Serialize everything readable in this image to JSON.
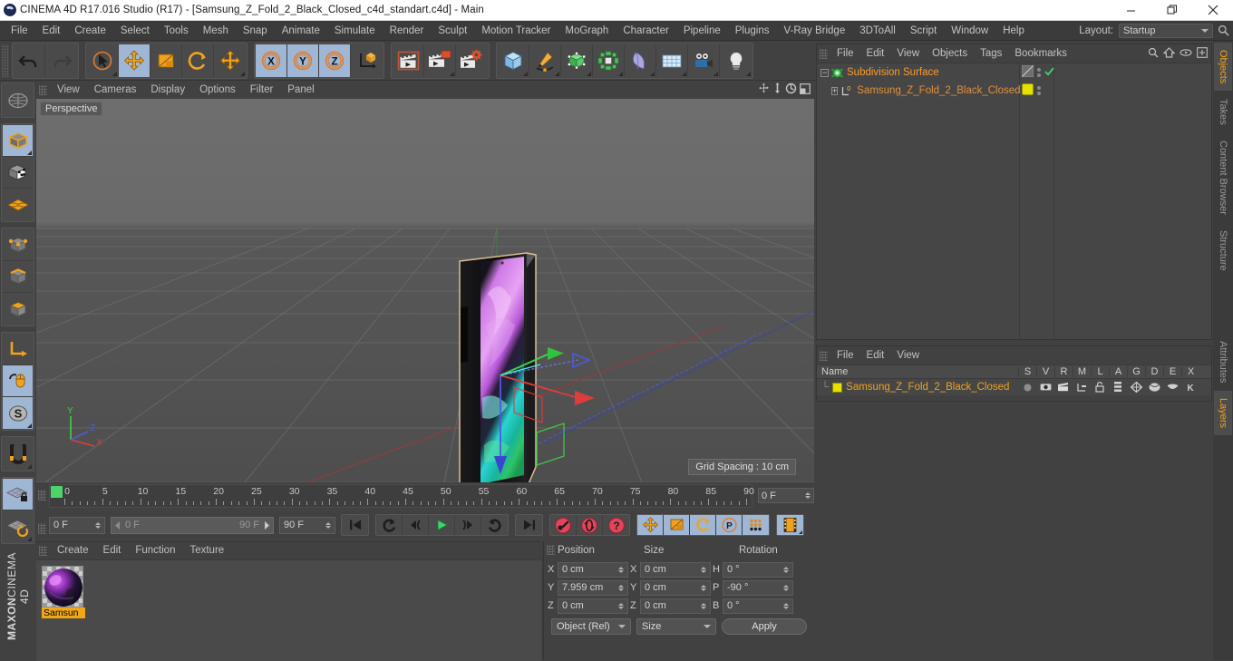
{
  "titlebar": {
    "title": "CINEMA 4D R17.016 Studio (R17) - [Samsung_Z_Fold_2_Black_Closed_c4d_standart.c4d] - Main",
    "minimize": "minimize-icon",
    "maximize": "maximize-icon",
    "close": "close-icon"
  },
  "menubar": {
    "items": [
      {
        "label": "File"
      },
      {
        "label": "Edit"
      },
      {
        "label": "Create"
      },
      {
        "label": "Select"
      },
      {
        "label": "Tools"
      },
      {
        "label": "Mesh"
      },
      {
        "label": "Snap"
      },
      {
        "label": "Animate"
      },
      {
        "label": "Simulate"
      },
      {
        "label": "Render"
      },
      {
        "label": "Sculpt"
      },
      {
        "label": "Motion Tracker"
      },
      {
        "label": "MoGraph"
      },
      {
        "label": "Character"
      },
      {
        "label": "Pipeline"
      },
      {
        "label": "Plugins"
      },
      {
        "label": "V-Ray Bridge"
      },
      {
        "label": "3DToAll"
      },
      {
        "label": "Script"
      },
      {
        "label": "Window"
      },
      {
        "label": "Help"
      }
    ],
    "layout_label": "Layout:",
    "layout_value": "Startup",
    "search_icon": "search-icon"
  },
  "toolbar": {
    "groups": [
      {
        "buttons": [
          {
            "name": "undo-button",
            "icon": "undo-arrow",
            "active": false,
            "corner": false
          },
          {
            "name": "redo-button",
            "icon": "redo-arrow",
            "active": false,
            "corner": false
          }
        ]
      },
      {
        "buttons": [
          {
            "name": "live-selection-tool",
            "icon": "cursor-circle",
            "active": false,
            "corner": true
          },
          {
            "name": "move-tool",
            "icon": "move-cross",
            "active": true,
            "corner": false
          },
          {
            "name": "scale-tool",
            "icon": "scale-box",
            "active": false,
            "corner": false
          },
          {
            "name": "rotate-tool",
            "icon": "rotate-arc",
            "active": false,
            "corner": false
          },
          {
            "name": "move-tool-alt",
            "icon": "move-cross",
            "active": false,
            "corner": true
          }
        ]
      },
      {
        "buttons": [
          {
            "name": "axis-x-toggle",
            "icon": "letter-x",
            "active": true,
            "corner": false
          },
          {
            "name": "axis-y-toggle",
            "icon": "letter-y",
            "active": true,
            "corner": false
          },
          {
            "name": "axis-z-toggle",
            "icon": "letter-z",
            "active": true,
            "corner": false
          },
          {
            "name": "coordinate-system-toggle",
            "icon": "axis-cube",
            "active": false,
            "corner": false
          }
        ]
      },
      {
        "buttons": [
          {
            "name": "render-view-button",
            "icon": "clapper-frame",
            "active": false,
            "corner": false
          },
          {
            "name": "render-to-picture-viewer-button",
            "icon": "clapper-window",
            "active": false,
            "corner": true
          },
          {
            "name": "render-settings-button",
            "icon": "clapper-gear",
            "active": false,
            "corner": false
          }
        ]
      },
      {
        "buttons": [
          {
            "name": "add-cube-button",
            "icon": "blue-cube",
            "active": false,
            "corner": true
          },
          {
            "name": "add-spline-button",
            "icon": "pen-spline",
            "active": false,
            "corner": true
          },
          {
            "name": "nurbs-button",
            "icon": "green-cube-points",
            "active": false,
            "corner": true
          },
          {
            "name": "array-button",
            "icon": "green-cluster",
            "active": false,
            "corner": true
          },
          {
            "name": "deformer-button",
            "icon": "bend-deformer",
            "active": false,
            "corner": true
          },
          {
            "name": "scene-floor-button",
            "icon": "floor-grid",
            "active": false,
            "corner": true
          },
          {
            "name": "camera-button",
            "icon": "camera",
            "active": false,
            "corner": true
          },
          {
            "name": "light-button",
            "icon": "light-bulb",
            "active": false,
            "corner": true
          }
        ]
      }
    ]
  },
  "left_toolbar": {
    "buttons": [
      {
        "name": "world-axis-tool",
        "icon": "globe-axis",
        "active": false,
        "corner": false
      },
      {
        "name": "model-mode-button",
        "icon": "orange-cube-outline",
        "active": true,
        "corner": true
      },
      {
        "name": "texture-mode-button",
        "icon": "checker-cube",
        "active": false,
        "corner": false
      },
      {
        "name": "polygon-mode-button",
        "icon": "orange-mesh-plane",
        "active": false,
        "corner": false
      },
      {
        "name": "point-mode-button",
        "icon": "cube-points",
        "active": false,
        "corner": false
      },
      {
        "name": "edge-mode-button",
        "icon": "cube-edge",
        "active": false,
        "corner": false
      },
      {
        "name": "polygon-face-mode-button",
        "icon": "cube-face",
        "active": false,
        "corner": false
      },
      {
        "name": "axis-modify-button",
        "icon": "corner-axis",
        "active": false,
        "corner": false
      },
      {
        "name": "enable-axis-button",
        "icon": "mouse-axis",
        "active": true,
        "corner": false
      },
      {
        "name": "soft-selection-button",
        "icon": "letter-s-circle",
        "active": true,
        "corner": true
      },
      {
        "name": "magnet-tool",
        "icon": "magnet",
        "active": false,
        "corner": true
      },
      {
        "name": "lock-workplane-button",
        "icon": "grid-lock",
        "active": true,
        "corner": false
      },
      {
        "name": "workplane-rotate-button",
        "icon": "grid-rotate",
        "active": false,
        "corner": true
      }
    ],
    "brand_top": "MAXON",
    "brand_bottom": "CINEMA 4D"
  },
  "viewport": {
    "menu": [
      {
        "label": "View"
      },
      {
        "label": "Cameras"
      },
      {
        "label": "Display"
      },
      {
        "label": "Options"
      },
      {
        "label": "Filter"
      },
      {
        "label": "Panel"
      }
    ],
    "nav_icons": [
      {
        "name": "pan-view-icon"
      },
      {
        "name": "dolly-view-icon"
      },
      {
        "name": "rotate-view-icon"
      },
      {
        "name": "maximize-view-icon"
      }
    ],
    "perspective_label": "Perspective",
    "grid_spacing": "Grid Spacing : 10 cm",
    "axis_labels": {
      "x": "X",
      "y": "Y",
      "z": "Z"
    },
    "colors": {
      "axis_x": "#e03c3c",
      "axis_y": "#3fd24a",
      "axis_z": "#4a5ae0",
      "background_top": "#6a6a6a",
      "background_bottom": "#4b4b4b"
    }
  },
  "timeline": {
    "ticks": [
      0,
      5,
      10,
      15,
      20,
      25,
      30,
      35,
      40,
      45,
      50,
      55,
      60,
      65,
      70,
      75,
      80,
      85,
      90
    ],
    "current_frame_field": "0 F",
    "start_field": "0 F",
    "range_start": "0 F",
    "range_end": "90 F",
    "end_field": "90 F"
  },
  "transport": {
    "buttons": [
      {
        "name": "go-to-start-button",
        "icon": "skip-start"
      },
      {
        "name": "go-to-previous-key-button",
        "icon": "prev-key"
      },
      {
        "name": "step-back-button",
        "icon": "step-back"
      },
      {
        "name": "play-button",
        "icon": "play-triangle"
      },
      {
        "name": "step-forward-button",
        "icon": "step-forward"
      },
      {
        "name": "go-to-next-key-button",
        "icon": "next-key"
      },
      {
        "name": "go-to-end-button",
        "icon": "skip-end"
      }
    ],
    "record_buttons": [
      {
        "name": "record-active-objects-button",
        "icon": "red-key"
      },
      {
        "name": "autokeying-button",
        "icon": "red-circle-arrows"
      },
      {
        "name": "keyframe-selection-button",
        "icon": "red-question"
      }
    ],
    "key_toggles": [
      {
        "name": "position-key-toggle",
        "icon": "move-cross",
        "active": true
      },
      {
        "name": "scale-key-toggle",
        "icon": "scale-box",
        "active": true
      },
      {
        "name": "rotation-key-toggle",
        "icon": "rotate-arc",
        "active": true
      },
      {
        "name": "pla-key-toggle",
        "icon": "letter-p-circle",
        "active": true
      },
      {
        "name": "parameter-key-toggle",
        "icon": "dots-grid",
        "active": true
      }
    ],
    "extra_button": {
      "name": "timeline-film-button",
      "icon": "film-strip",
      "active": true
    }
  },
  "material_manager": {
    "menu": [
      {
        "label": "Create"
      },
      {
        "label": "Edit"
      },
      {
        "label": "Function"
      },
      {
        "label": "Texture"
      }
    ],
    "materials": [
      {
        "name": "Samsun"
      }
    ]
  },
  "coordinates": {
    "headers": {
      "position": "Position",
      "size": "Size",
      "rotation": "Rotation"
    },
    "rows": [
      {
        "pos_axis": "X",
        "pos_value": "0 cm",
        "size_axis": "X",
        "size_value": "0 cm",
        "rot_axis": "H",
        "rot_value": "0 °"
      },
      {
        "pos_axis": "Y",
        "pos_value": "7.959 cm",
        "size_axis": "Y",
        "size_value": "0 cm",
        "rot_axis": "P",
        "rot_value": "-90 °"
      },
      {
        "pos_axis": "Z",
        "pos_value": "0 cm",
        "size_axis": "Z",
        "size_value": "0 cm",
        "rot_axis": "B",
        "rot_value": "0 °"
      }
    ],
    "mode_dropdown": "Object (Rel)",
    "size_dropdown": "Size",
    "apply_button": "Apply"
  },
  "object_manager": {
    "menu": [
      {
        "label": "File"
      },
      {
        "label": "Edit"
      },
      {
        "label": "View"
      },
      {
        "label": "Objects"
      },
      {
        "label": "Tags"
      },
      {
        "label": "Bookmarks"
      }
    ],
    "icons": [
      {
        "name": "search-icon"
      },
      {
        "name": "home-icon"
      },
      {
        "name": "eye-icon"
      },
      {
        "name": "new-window-icon"
      }
    ],
    "items": [
      {
        "label": "Subdivision Surface",
        "icon": "subdivision-surface-icon",
        "selected": true,
        "indent": 0
      },
      {
        "label": "Samsung_Z_Fold_2_Black_Closed",
        "icon": "polygon-object-icon",
        "selected": false,
        "indent": 1
      }
    ]
  },
  "layer_manager": {
    "menu": [
      {
        "label": "File"
      },
      {
        "label": "Edit"
      },
      {
        "label": "View"
      }
    ],
    "columns": [
      "Name",
      "S",
      "V",
      "R",
      "M",
      "L",
      "A",
      "G",
      "D",
      "E",
      "X"
    ],
    "rows": [
      {
        "name": "Samsung_Z_Fold_2_Black_Closed",
        "color": "#e8e000"
      }
    ]
  },
  "right_tabs": {
    "top": [
      {
        "label": "Objects",
        "active": true
      },
      {
        "label": "Takes",
        "active": false
      },
      {
        "label": "Content Browser",
        "active": false
      },
      {
        "label": "Structure",
        "active": false
      }
    ],
    "bottom": [
      {
        "label": "Attributes",
        "active": false
      },
      {
        "label": "Layers",
        "active": true
      }
    ]
  }
}
